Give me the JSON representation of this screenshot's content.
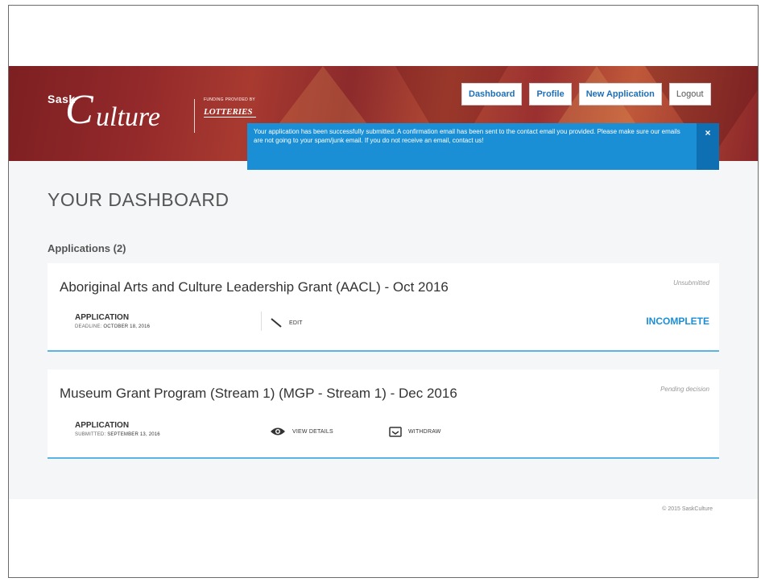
{
  "header": {
    "logo_sask": "Sask",
    "logo_c": "C",
    "logo_rest": "ulture",
    "funding_text": "FUNDING PROVIDED BY",
    "lotteries_text": "LOTTERIES"
  },
  "nav": {
    "dashboard": "Dashboard",
    "profile": "Profile",
    "new_application": "New Application",
    "logout": "Logout"
  },
  "notice": {
    "message": "Your application has been successfully submitted. A confirmation email has been sent to the contact email you provided. Please make sure our emails are not going to your spam/junk email. If you do not receive an email, contact us!",
    "close": "×"
  },
  "page": {
    "title": "YOUR DASHBOARD",
    "applications_heading": "Applications (2)"
  },
  "applications": [
    {
      "title": "Aboriginal Arts and Culture Leadership Grant (AACL) - Oct 2016",
      "status": "Unsubmitted",
      "label": "APPLICATION",
      "date_prefix": "DEADLINE:",
      "date_value": "OCTOBER 18, 2016",
      "action_1": "EDIT",
      "progress": "INCOMPLETE"
    },
    {
      "title": "Museum Grant Program (Stream 1) (MGP - Stream 1) - Dec 2016",
      "status": "Pending decision",
      "label": "APPLICATION",
      "date_prefix": "SUBMITTED:",
      "date_value": "SEPTEMBER 13, 2016",
      "action_1": "VIEW DETAILS",
      "action_2": "WITHDRAW"
    }
  ],
  "footer": {
    "copyright": "© 2015 SaskCulture"
  },
  "colors": {
    "banner": "#93292a",
    "accent_blue": "#1a8fd6",
    "card_border": "#5bb5e4"
  },
  "icons": [
    "pencil-icon",
    "eye-icon",
    "withdraw-box-icon",
    "close-icon"
  ]
}
